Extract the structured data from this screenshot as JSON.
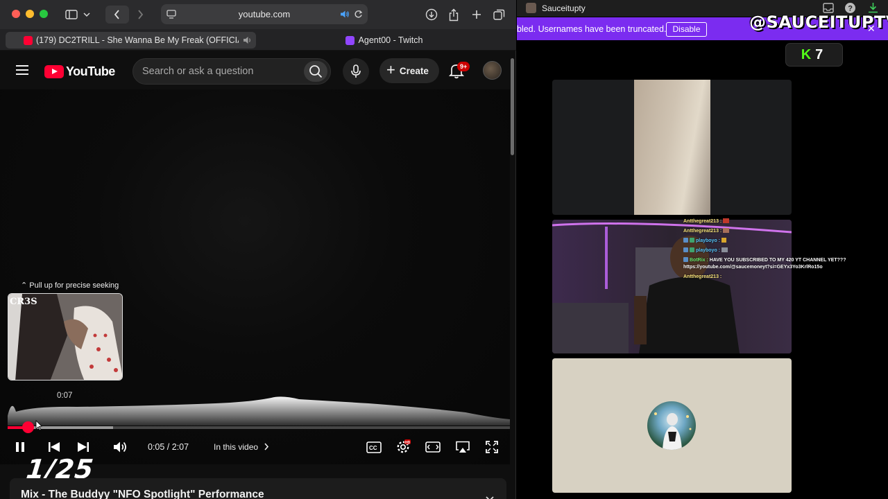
{
  "safari": {
    "url": "youtube.com",
    "tabs": [
      {
        "label": "(179) DC2TRILL - She Wanna Be My Freak (OFFICIAL..."
      },
      {
        "label": "Agent00 - Twitch"
      }
    ]
  },
  "youtube": {
    "logo_text": "YouTube",
    "search_placeholder": "Search or ask a question",
    "create_label": "Create",
    "notification_count": "9+",
    "player": {
      "pull_up_hint": "Pull up for precise seeking",
      "preview_time": "0:07",
      "thumb_logo": "CR3S",
      "current_time": "0:05",
      "duration": "2:07",
      "time_display": "0:05 / 2:07",
      "in_this_video": "In this video",
      "played_fraction": 0.04,
      "buffered_fraction": 0.21,
      "playlist_index": "1/25"
    },
    "title": "Mix - The Buddyy \"NFO Spotlight\" Performance"
  },
  "twitch": {
    "window_title": "Sauceitupty",
    "banner_text": "bled. Usernames have been truncated.",
    "disable_label": "Disable",
    "overlay_handle": "@SAUCEITUPTV",
    "badge": {
      "k": "K",
      "s": "7"
    },
    "chat": [
      {
        "user": "Antthegreat213 :",
        "msg": ""
      },
      {
        "user": "Antthegreat213 :",
        "msg": ""
      },
      {
        "user": "playboyo :",
        "msg": ""
      },
      {
        "user": "playboyo :",
        "msg": ""
      },
      {
        "user": "BotRix :",
        "msg": "HAVE YOU SUBSCRIBED TO MY 420 YT CHANNEL YET???"
      },
      {
        "user": "",
        "msg": "https://youtube.com/@saucemoneyt?si=GEYx3Yo3KrlRo15o"
      },
      {
        "user": "Antthegreat213 :",
        "msg": ""
      }
    ]
  },
  "colors": {
    "yt_red": "#ff0033",
    "twitch_purple": "#7b2cf0",
    "kick_green": "#53fc18"
  }
}
